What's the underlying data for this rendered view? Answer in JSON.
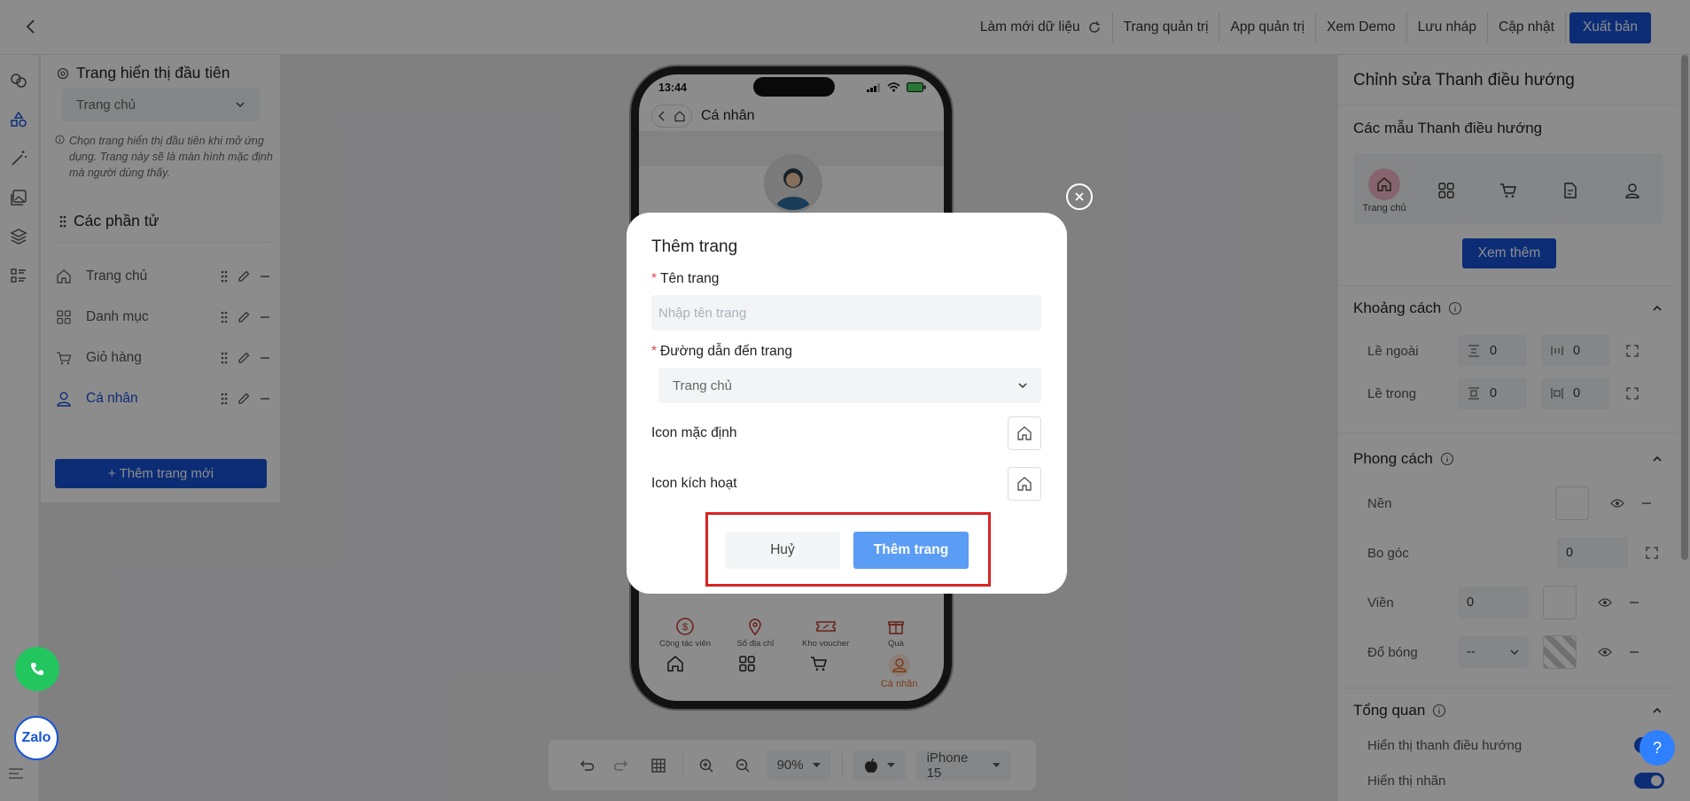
{
  "topbar": {
    "refresh": "Làm mới dữ liệu",
    "admin_page": "Trang quản trị",
    "admin_app": "App quản trị",
    "demo": "Xem Demo",
    "save_draft": "Lưu nháp",
    "update": "Cập nhật",
    "publish": "Xuất bản"
  },
  "left_panel": {
    "first_page_title": "Trang hiển thị đầu tiên",
    "first_page_value": "Trang chủ",
    "hint": "Chọn trang hiển thị đầu tiên khi mở ứng dụng. Trang này sẽ là màn hình mặc định mà người dùng thấy.",
    "elements_title": "Các phần tử",
    "items": [
      {
        "label": "Trang chủ",
        "icon": "home-icon"
      },
      {
        "label": "Danh mục",
        "icon": "grid-icon"
      },
      {
        "label": "Giỏ hàng",
        "icon": "cart-icon"
      },
      {
        "label": "Cá nhân",
        "icon": "user-icon",
        "active": true
      }
    ],
    "add_button": "+ Thêm trang mới"
  },
  "phone": {
    "time": "13:44",
    "title": "Cá nhân",
    "quick_links": [
      "Cộng tác viên",
      "Sổ địa chỉ",
      "Kho voucher",
      "Quà"
    ],
    "active_tab": "Cá nhân",
    "accent": "#e06a2b"
  },
  "toolbar": {
    "zoom": "90%",
    "device": "iPhone 15"
  },
  "right_panel": {
    "title": "Chỉnh sửa Thanh điều hướng",
    "templates_title": "Các mẫu Thanh điều hướng",
    "template_active_label": "Trang chủ",
    "more_button": "Xem thêm",
    "spacing": {
      "title": "Khoảng cách",
      "outer_label": "Lề ngoài",
      "inner_label": "Lề trong",
      "outer_v": "0",
      "outer_h": "0",
      "inner_v": "0",
      "inner_h": "0"
    },
    "style": {
      "title": "Phong cách",
      "bg_label": "Nền",
      "radius_label": "Bo góc",
      "radius_value": "0",
      "border_label": "Viền",
      "border_value": "0",
      "shadow_label": "Đổ bóng",
      "shadow_value": "--"
    },
    "overview": {
      "title": "Tổng quan",
      "show_nav": "Hiển thị thanh điều hướng",
      "show_labels": "Hiển thị nhãn"
    }
  },
  "floating": {
    "zalo": "Zalo",
    "help": "?"
  },
  "modal": {
    "title": "Thêm trang",
    "name_label": "Tên trang",
    "name_placeholder": "Nhập tên trang",
    "path_label": "Đường dẫn đến trang",
    "path_value": "Trang chủ",
    "default_icon_label": "Icon mặc định",
    "active_icon_label": "Icon kích hoạt",
    "cancel": "Huỷ",
    "submit": "Thêm trang",
    "required_mark": "*",
    "highlight_color": "#d82424"
  },
  "colors": {
    "primary": "#1652d8",
    "submit": "#5b9cf4",
    "call": "#22c55e"
  }
}
